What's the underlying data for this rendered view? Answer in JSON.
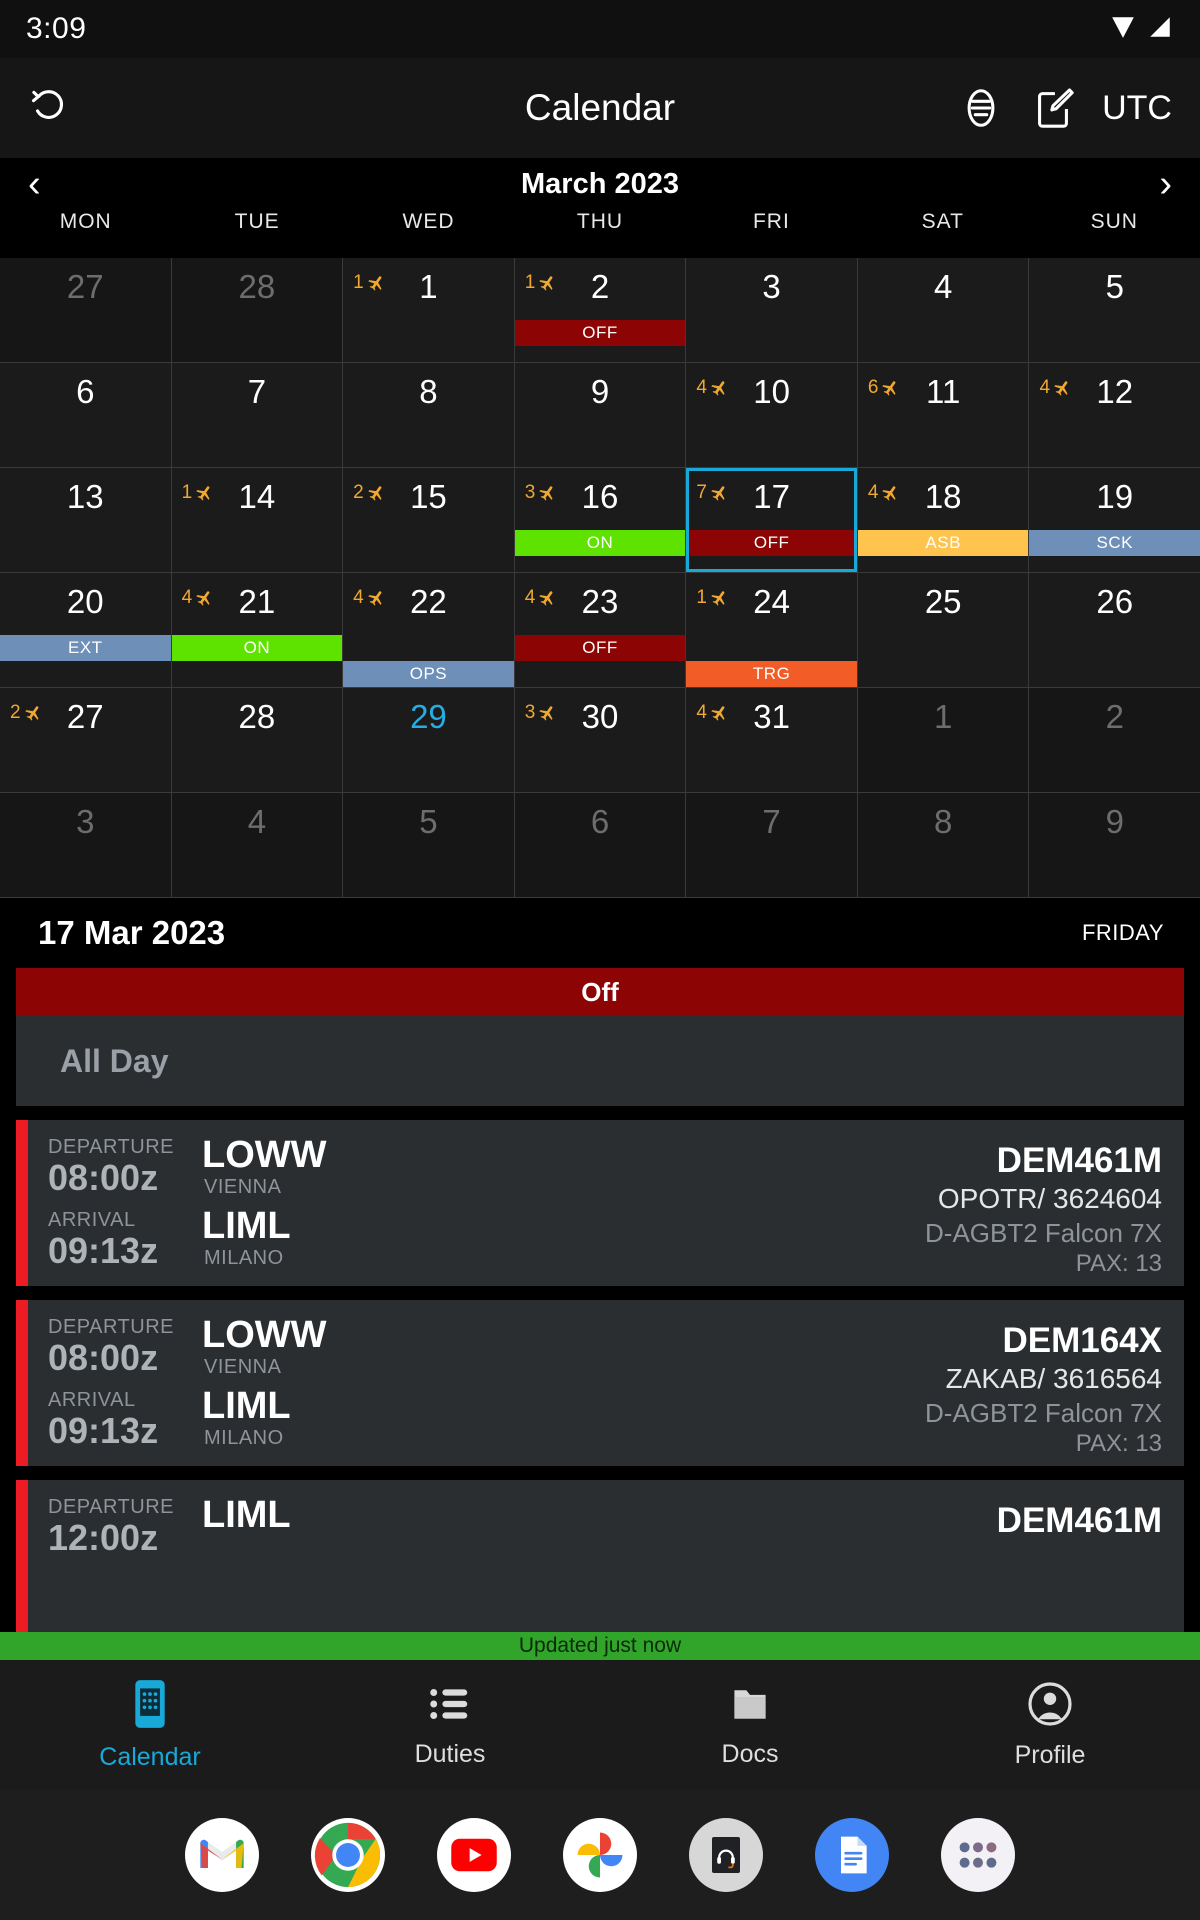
{
  "status_bar": {
    "clock": "3:09",
    "wifi_icon": "wifi-icon",
    "signal_icon": "cell-signal-icon"
  },
  "app_bar": {
    "title": "Calendar",
    "refresh_icon": "refresh-icon",
    "filter_icon": "filter-icon",
    "edit_icon": "edit-icon",
    "timezone_label": "UTC"
  },
  "calendar": {
    "month_label": "March 2023",
    "prev_icon": "chevron-left-icon",
    "next_icon": "chevron-right-icon",
    "weekday_headers": [
      "MON",
      "TUE",
      "WED",
      "THU",
      "FRI",
      "SAT",
      "SUN"
    ],
    "accent_selected": "#19a9d8",
    "accent_today": "#26aee0",
    "flight_count_color": "#f0a830",
    "badge_colors": {
      "OFF": "#8c0404",
      "ON": "#5ee300",
      "ASB": "#ffc council",
      "SCK": "#6d8fb8",
      "EXT": "#6d8fb8",
      "OPS": "#6d8fb8",
      "TRG": "#f25c26"
    },
    "weeks": [
      [
        {
          "day": "27",
          "out": true,
          "flights": null,
          "badges": []
        },
        {
          "day": "28",
          "out": true,
          "flights": null,
          "badges": []
        },
        {
          "day": "1",
          "out": false,
          "flights": "1",
          "badges": []
        },
        {
          "day": "2",
          "out": false,
          "flights": "1",
          "badges": [
            {
              "label": "OFF",
              "color": "#8c0404"
            }
          ]
        },
        {
          "day": "3",
          "out": false,
          "flights": null,
          "badges": []
        },
        {
          "day": "4",
          "out": false,
          "flights": null,
          "badges": []
        },
        {
          "day": "5",
          "out": false,
          "flights": null,
          "badges": []
        }
      ],
      [
        {
          "day": "6",
          "out": false,
          "flights": null,
          "badges": []
        },
        {
          "day": "7",
          "out": false,
          "flights": null,
          "badges": []
        },
        {
          "day": "8",
          "out": false,
          "flights": null,
          "badges": []
        },
        {
          "day": "9",
          "out": false,
          "flights": null,
          "badges": []
        },
        {
          "day": "10",
          "out": false,
          "flights": "4",
          "badges": []
        },
        {
          "day": "11",
          "out": false,
          "flights": "6",
          "badges": []
        },
        {
          "day": "12",
          "out": false,
          "flights": "4",
          "badges": []
        }
      ],
      [
        {
          "day": "13",
          "out": false,
          "flights": null,
          "badges": []
        },
        {
          "day": "14",
          "out": false,
          "flights": "1",
          "badges": []
        },
        {
          "day": "15",
          "out": false,
          "flights": "2",
          "badges": []
        },
        {
          "day": "16",
          "out": false,
          "flights": "3",
          "badges": [
            {
              "label": "ON",
              "color": "#5ee300"
            }
          ]
        },
        {
          "day": "17",
          "out": false,
          "flights": "7",
          "selected": true,
          "badges": [
            {
              "label": "OFF",
              "color": "#8c0404"
            }
          ]
        },
        {
          "day": "18",
          "out": false,
          "flights": "4",
          "badges": [
            {
              "label": "ASB",
              "color": "#ffc44d"
            }
          ]
        },
        {
          "day": "19",
          "out": false,
          "flights": null,
          "badges": [
            {
              "label": "SCK",
              "color": "#6d8fb8"
            }
          ]
        }
      ],
      [
        {
          "day": "20",
          "out": false,
          "flights": null,
          "badges": [
            {
              "label": "EXT",
              "color": "#6d8fb8"
            }
          ]
        },
        {
          "day": "21",
          "out": false,
          "flights": "4",
          "badges": [
            {
              "label": "ON",
              "color": "#5ee300"
            }
          ]
        },
        {
          "day": "22",
          "out": false,
          "flights": "4",
          "badges": [
            {
              "label": "",
              "color": "transparent"
            },
            {
              "label": "OPS",
              "color": "#6d8fb8"
            }
          ]
        },
        {
          "day": "23",
          "out": false,
          "flights": "4",
          "badges": [
            {
              "label": "OFF",
              "color": "#8c0404"
            }
          ]
        },
        {
          "day": "24",
          "out": false,
          "flights": "1",
          "badges": [
            {
              "label": "",
              "color": "transparent"
            },
            {
              "label": "TRG",
              "color": "#f25c26"
            }
          ]
        },
        {
          "day": "25",
          "out": false,
          "flights": null,
          "badges": []
        },
        {
          "day": "26",
          "out": false,
          "flights": null,
          "badges": []
        }
      ],
      [
        {
          "day": "27",
          "out": false,
          "flights": "2",
          "badges": []
        },
        {
          "day": "28",
          "out": false,
          "flights": null,
          "badges": []
        },
        {
          "day": "29",
          "out": false,
          "today": true,
          "flights": null,
          "badges": []
        },
        {
          "day": "30",
          "out": false,
          "flights": "3",
          "badges": []
        },
        {
          "day": "31",
          "out": false,
          "flights": "4",
          "badges": []
        },
        {
          "day": "1",
          "out": true,
          "flights": null,
          "badges": []
        },
        {
          "day": "2",
          "out": true,
          "flights": null,
          "badges": []
        }
      ],
      [
        {
          "day": "3",
          "out": true,
          "flights": null,
          "badges": []
        },
        {
          "day": "4",
          "out": true,
          "flights": null,
          "badges": []
        },
        {
          "day": "5",
          "out": true,
          "flights": null,
          "badges": []
        },
        {
          "day": "6",
          "out": true,
          "flights": null,
          "badges": []
        },
        {
          "day": "7",
          "out": true,
          "flights": null,
          "badges": []
        },
        {
          "day": "8",
          "out": true,
          "flights": null,
          "badges": []
        },
        {
          "day": "9",
          "out": true,
          "flights": null,
          "badges": []
        }
      ]
    ]
  },
  "day_detail": {
    "date_label": "17 Mar 2023",
    "weekday_label": "FRIDAY",
    "duty_banner": "Off",
    "all_day_label": "All Day",
    "flights": [
      {
        "departure_label": "DEPARTURE",
        "departure_time": "08:00z",
        "arrival_label": "ARRIVAL",
        "arrival_time": "09:13z",
        "from_icao": "LOWW",
        "from_city": "VIENNA",
        "to_icao": "LIML",
        "to_city": "MILANO",
        "flight_number": "DEM461M",
        "reference": "OPOTR/ 3624604",
        "aircraft": "D-AGBT2 Falcon 7X",
        "pax": "PAX: 13"
      },
      {
        "departure_label": "DEPARTURE",
        "departure_time": "08:00z",
        "arrival_label": "ARRIVAL",
        "arrival_time": "09:13z",
        "from_icao": "LOWW",
        "from_city": "VIENNA",
        "to_icao": "LIML",
        "to_city": "MILANO",
        "flight_number": "DEM164X",
        "reference": "ZAKAB/ 3616564",
        "aircraft": "D-AGBT2 Falcon 7X",
        "pax": "PAX: 13"
      },
      {
        "departure_label": "DEPARTURE",
        "departure_time": "12:00z",
        "arrival_label": "",
        "arrival_time": "",
        "from_icao": "LIML",
        "from_city": "",
        "to_icao": "",
        "to_city": "",
        "flight_number": "DEM461M",
        "reference": "",
        "aircraft": "",
        "pax": ""
      }
    ]
  },
  "toast": {
    "message": "Updated just now",
    "color": "#31a52a"
  },
  "tab_bar": {
    "items": [
      {
        "label": "Calendar",
        "icon": "calendar-icon",
        "active": true
      },
      {
        "label": "Duties",
        "icon": "list-icon",
        "active": false
      },
      {
        "label": "Docs",
        "icon": "folder-icon",
        "active": false
      },
      {
        "label": "Profile",
        "icon": "person-circle-icon",
        "active": false
      }
    ]
  },
  "dock": {
    "apps": [
      {
        "name": "gmail-icon"
      },
      {
        "name": "chrome-icon"
      },
      {
        "name": "youtube-icon"
      },
      {
        "name": "google-photos-icon"
      },
      {
        "name": "support-headset-icon"
      },
      {
        "name": "google-docs-icon"
      },
      {
        "name": "app-drawer-icon"
      }
    ]
  }
}
